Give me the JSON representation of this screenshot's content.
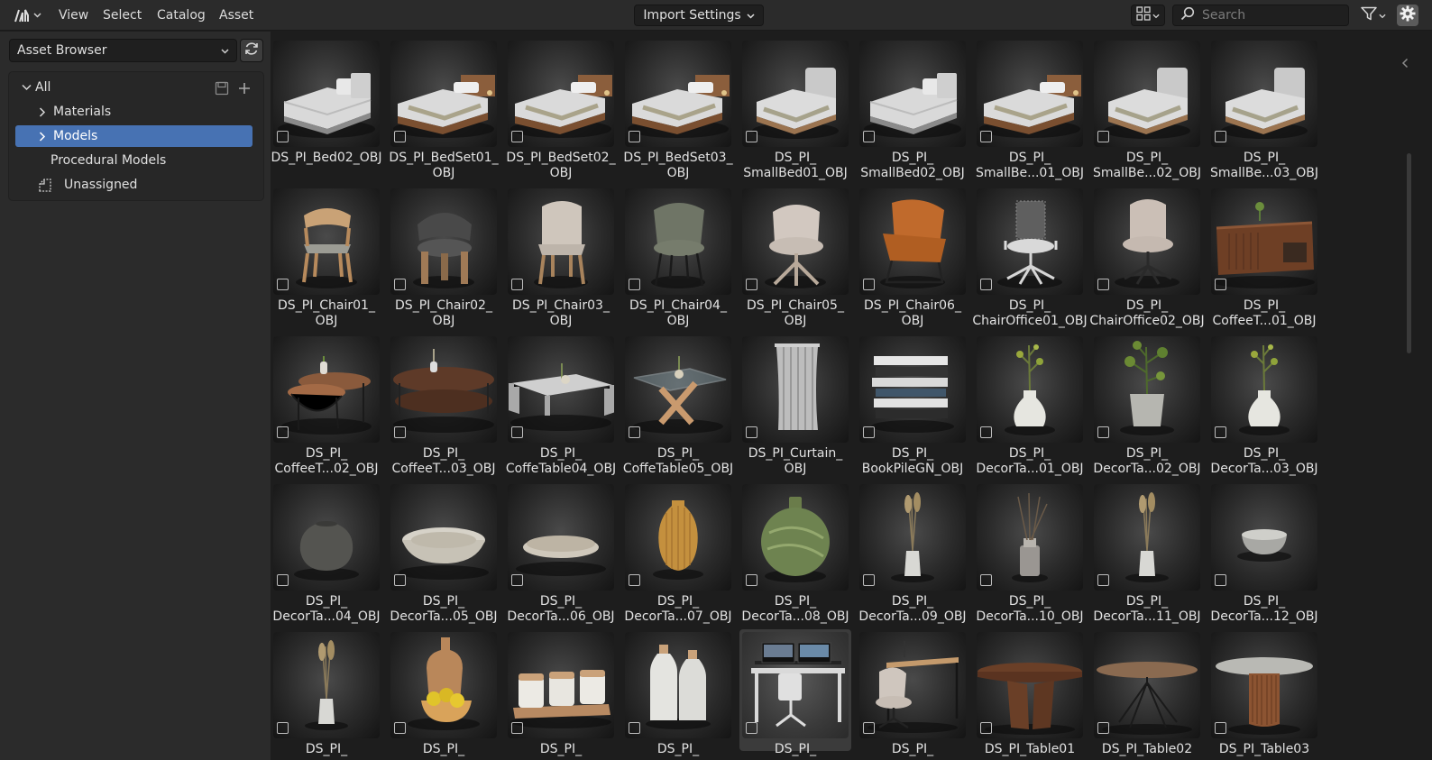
{
  "header": {
    "menus": [
      "View",
      "Select",
      "Catalog",
      "Asset"
    ],
    "import_settings": "Import Settings",
    "search_placeholder": "Search",
    "icons": {
      "editor": "asset-browser-editor-icon",
      "view_mode": "thumbnail-grid-icon",
      "search": "search-icon",
      "filter": "funnel-filter-icon",
      "settings": "gear-icon"
    }
  },
  "sidebar": {
    "library": "Asset Browser",
    "catalogs": [
      {
        "label": "All",
        "expanded": true
      },
      {
        "label": "Materials",
        "expandable": true
      },
      {
        "label": "Models",
        "expandable": true,
        "active": true
      },
      {
        "label": "Procedural Models"
      },
      {
        "label": "Unassigned"
      }
    ]
  },
  "assets": [
    {
      "label": "DS_PI_Bed02_OBJ",
      "kind": "bed"
    },
    {
      "label": "DS_PI_BedSet01_\nOBJ",
      "kind": "bedset"
    },
    {
      "label": "DS_PI_BedSet02_\nOBJ",
      "kind": "bedset"
    },
    {
      "label": "DS_PI_BedSet03_\nOBJ",
      "kind": "bedset"
    },
    {
      "label": "DS_PI_\nSmallBed01_OBJ",
      "kind": "smallbed"
    },
    {
      "label": "DS_PI_\nSmallBed02_OBJ",
      "kind": "bed"
    },
    {
      "label": "DS_PI_\nSmallBe...01_OBJ",
      "kind": "bedset"
    },
    {
      "label": "DS_PI_\nSmallBe...02_OBJ",
      "kind": "smallbed"
    },
    {
      "label": "DS_PI_\nSmallBe...03_OBJ",
      "kind": "smallbed"
    },
    {
      "label": "DS_PI_Chair01_\nOBJ",
      "kind": "chair-wood"
    },
    {
      "label": "DS_PI_Chair02_\nOBJ",
      "kind": "chair-dark"
    },
    {
      "label": "DS_PI_Chair03_\nOBJ",
      "kind": "chair-beige"
    },
    {
      "label": "DS_PI_Chair04_\nOBJ",
      "kind": "chair-green"
    },
    {
      "label": "DS_PI_Chair05_\nOBJ",
      "kind": "chair-swivel"
    },
    {
      "label": "DS_PI_Chair06_\nOBJ",
      "kind": "chair-leather"
    },
    {
      "label": "DS_PI_\nChairOffice01_OBJ",
      "kind": "office"
    },
    {
      "label": "DS_PI_\nChairOffice02_OBJ",
      "kind": "office-beige"
    },
    {
      "label": "DS_PI_\nCoffeeT...01_OBJ",
      "kind": "sideboard"
    },
    {
      "label": "DS_PI_\nCoffeeT...02_OBJ",
      "kind": "nesting-table"
    },
    {
      "label": "DS_PI_\nCoffeeT...03_OBJ",
      "kind": "oval-table"
    },
    {
      "label": "DS_PI_\nCoffeTable04_OBJ",
      "kind": "white-table"
    },
    {
      "label": "DS_PI_\nCoffeTable05_OBJ",
      "kind": "glass-table"
    },
    {
      "label": "DS_PI_Curtain_\nOBJ",
      "kind": "curtain"
    },
    {
      "label": "DS_PI_\nBookPileGN_OBJ",
      "kind": "books"
    },
    {
      "label": "DS_PI_\nDecorTa...01_OBJ",
      "kind": "vase-plant"
    },
    {
      "label": "DS_PI_\nDecorTa...02_OBJ",
      "kind": "pot-plant"
    },
    {
      "label": "DS_PI_\nDecorTa...03_OBJ",
      "kind": "vase-plant"
    },
    {
      "label": "DS_PI_\nDecorTa...04_OBJ",
      "kind": "round-vase"
    },
    {
      "label": "DS_PI_\nDecorTa...05_OBJ",
      "kind": "bowl"
    },
    {
      "label": "DS_PI_\nDecorTa...06_OBJ",
      "kind": "tray"
    },
    {
      "label": "DS_PI_\nDecorTa...07_OBJ",
      "kind": "ribbed-vase"
    },
    {
      "label": "DS_PI_\nDecorTa...08_OBJ",
      "kind": "green-vase"
    },
    {
      "label": "DS_PI_\nDecorTa...09_OBJ",
      "kind": "dry-vase"
    },
    {
      "label": "DS_PI_\nDecorTa...10_OBJ",
      "kind": "diffuser"
    },
    {
      "label": "DS_PI_\nDecorTa...11_OBJ",
      "kind": "dry-vase"
    },
    {
      "label": "DS_PI_\nDecorTa...12_OBJ",
      "kind": "small-bowl"
    },
    {
      "label": "DS_PI_",
      "kind": "dry-vase"
    },
    {
      "label": "DS_PI_",
      "kind": "fruit-board"
    },
    {
      "label": "DS_PI_",
      "kind": "jars"
    },
    {
      "label": "DS_PI_",
      "kind": "bottles"
    },
    {
      "label": "DS_PI_",
      "kind": "desk-setup",
      "selected": true
    },
    {
      "label": "DS_PI_",
      "kind": "desk-chair"
    },
    {
      "label": "DS_PI_Table01",
      "kind": "dining-table"
    },
    {
      "label": "DS_PI_Table02",
      "kind": "x-table"
    },
    {
      "label": "DS_PI_Table03",
      "kind": "round-table"
    }
  ]
}
